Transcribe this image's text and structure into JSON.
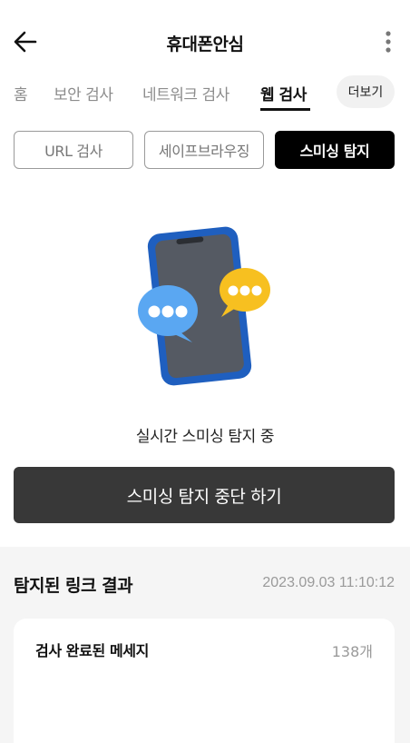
{
  "header": {
    "title": "휴대폰안심",
    "back_icon": "arrow-left-icon",
    "more_icon": "more-vertical-icon"
  },
  "tabs": [
    {
      "label": "홈",
      "active": false
    },
    {
      "label": "보안 검사",
      "active": false
    },
    {
      "label": "네트워크 검사",
      "active": false
    },
    {
      "label": "웹 검사",
      "active": true
    }
  ],
  "tab_more": {
    "label": "더보기"
  },
  "segments": [
    {
      "label": "URL 검사",
      "selected": false
    },
    {
      "label": "세이프브라우징",
      "selected": false
    },
    {
      "label": "스미싱 탐지",
      "selected": true
    }
  ],
  "illustration": {
    "icon": "phone-chat-bubbles-icon"
  },
  "status_text": "실시간 스미싱 탐지 중",
  "stop_button": {
    "label": "스미싱 탐지 중단 하기"
  },
  "results": {
    "title": "탐지된 링크 결과",
    "timestamp": "2023.09.03 11:10:12",
    "card": {
      "label": "검사 완료된 메세지",
      "count": "138개"
    }
  },
  "colors": {
    "accent_dark": "#000000",
    "button_dark": "#383838",
    "section_bg": "#f5f5f5",
    "muted_text": "#9a9a9a"
  }
}
